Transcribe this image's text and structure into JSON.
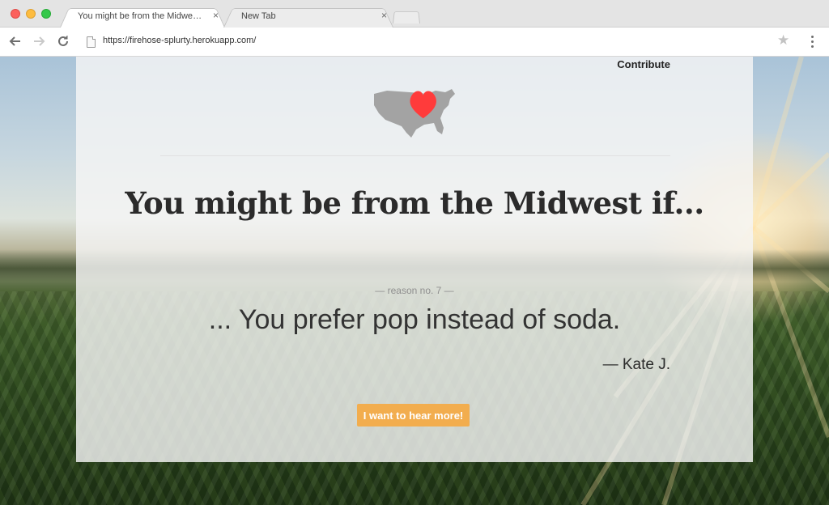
{
  "browser": {
    "tabs": [
      {
        "title": "You might be from the Midwest if...",
        "active": true
      },
      {
        "title": "New Tab",
        "active": false
      }
    ],
    "close_glyph": "×",
    "url": "https://firehose-splurty.herokuapp.com/",
    "icons": {
      "back": "arrow-left-icon",
      "forward": "arrow-right-icon",
      "reload": "reload-icon",
      "bookmark": "star-icon",
      "menu": "kebab-menu-icon"
    }
  },
  "page": {
    "nav": {
      "contribute": "Contribute"
    },
    "logo": {
      "icon": "us-map-heart-icon",
      "heart_color": "#ff3b3b",
      "map_color": "#a3a3a3"
    },
    "headline": "You might be from the Midwest if...",
    "reason_label": "— reason no. 7 —",
    "reason_text": "... You prefer pop instead of soda.",
    "author": "— Kate J.",
    "cta": {
      "label": "I want to hear more!",
      "color": "#f2ad4e"
    }
  }
}
